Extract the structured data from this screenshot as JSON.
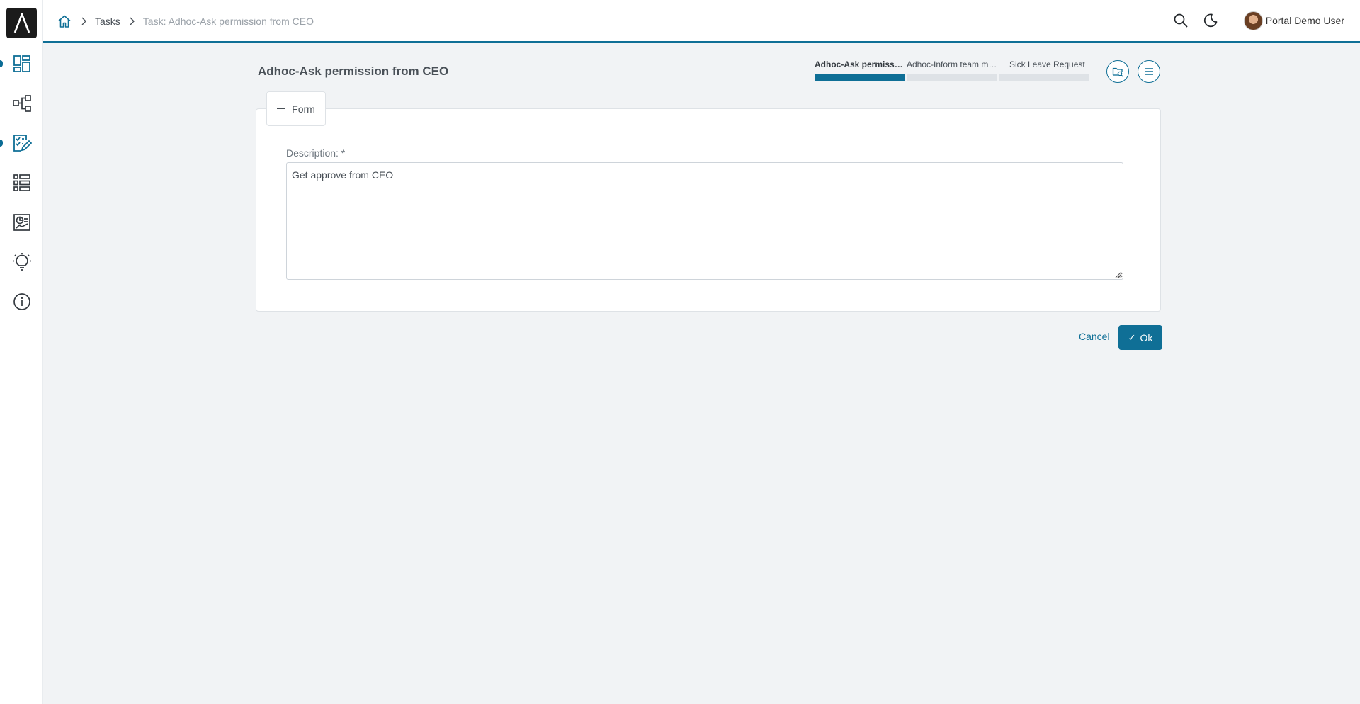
{
  "app": {
    "user_name": "Portal Demo User"
  },
  "breadcrumb": {
    "items": [
      "Tasks"
    ],
    "current": "Task: Adhoc-Ask permission from CEO"
  },
  "sidebar": {
    "items": [
      {
        "icon": "dashboard-icon",
        "active": true
      },
      {
        "icon": "process-icon",
        "active": false
      },
      {
        "icon": "task-icon",
        "active": true
      },
      {
        "icon": "case-list-icon",
        "active": false
      },
      {
        "icon": "statistics-icon",
        "active": false
      },
      {
        "icon": "idea-icon",
        "active": false
      },
      {
        "icon": "info-icon",
        "active": false
      }
    ]
  },
  "task": {
    "title": "Adhoc-Ask permission from CEO",
    "steps": [
      {
        "label": "Adhoc-Ask permission from CEO",
        "active": true
      },
      {
        "label": "Adhoc-Inform team members",
        "active": false
      },
      {
        "label": "Sick Leave Request",
        "active": false
      }
    ]
  },
  "form": {
    "legend": "Form",
    "description_label": "Description: *",
    "description_value": "Get approve from CEO"
  },
  "actions": {
    "cancel_label": "Cancel",
    "ok_label": "Ok"
  },
  "colors": {
    "accent": "#0f6f96",
    "background": "#f1f3f5",
    "surface": "#ffffff"
  }
}
